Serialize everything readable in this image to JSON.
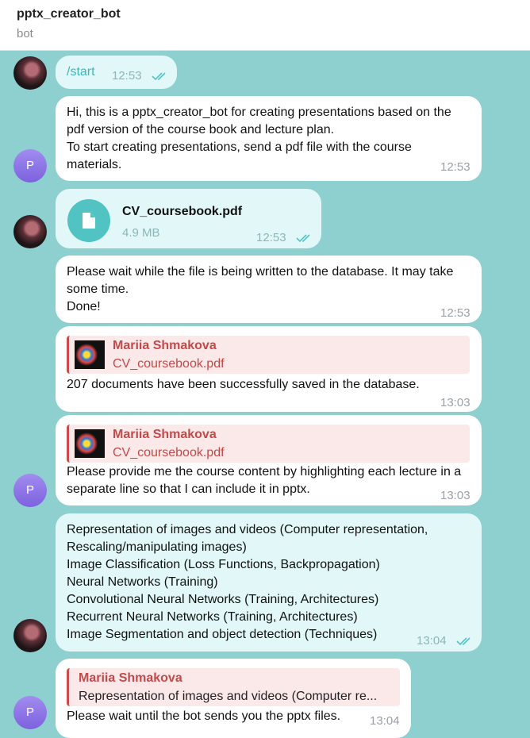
{
  "header": {
    "title": "pptx_creator_bot",
    "subtitle": "bot"
  },
  "avatars": {
    "bot_letter": "P"
  },
  "messages": {
    "m1": {
      "text": "/start",
      "time": "12:53"
    },
    "m2": {
      "text": "Hi, this is a pptx_creator_bot for creating presentations based on the pdf version of the course book and lecture plan.\nTo start creating presentations, send a pdf file with the course materials.",
      "time": "12:53"
    },
    "m3": {
      "file_name": "CV_coursebook.pdf",
      "file_size": "4.9 MB",
      "time": "12:53"
    },
    "m4": {
      "text": "Please wait while the file is being written to the database. It may take some time.\nDone!",
      "time": "12:53"
    },
    "m5": {
      "reply_name": "Mariia Shmakova",
      "reply_text": "CV_coursebook.pdf",
      "text": "207 documents have been successfully saved in the database.",
      "time": "13:03"
    },
    "m6": {
      "reply_name": "Mariia Shmakova",
      "reply_text": "CV_coursebook.pdf",
      "text": "Please provide me the course content by highlighting each lecture in a separate line so that I can include it in pptx.",
      "time": "13:03"
    },
    "m7": {
      "text": "Representation of images and videos (Computer representation, Rescaling/manipulating images)\nImage Classification (Loss Functions, Backpropagation)\nNeural Networks (Training)\nConvolutional Neural Networks  (Training, Architectures)\nRecurrent Neural Networks (Training, Architectures)\nImage Segmentation and object detection (Techniques)",
      "time": "13:04"
    },
    "m8": {
      "reply_name": "Mariia Shmakova",
      "reply_text": "Representation of images and videos (Computer re...",
      "text": "Please wait until the bot sends you the pptx files.",
      "time": "13:04"
    }
  },
  "colors": {
    "background": "#8ecfd0",
    "outgoing": "#e2f8f8",
    "incoming": "#ffffff",
    "reply_accent": "#cc4a4a",
    "file_icon": "#51c3c3"
  },
  "icons": {
    "read": "double-check-icon",
    "file": "document-icon"
  }
}
